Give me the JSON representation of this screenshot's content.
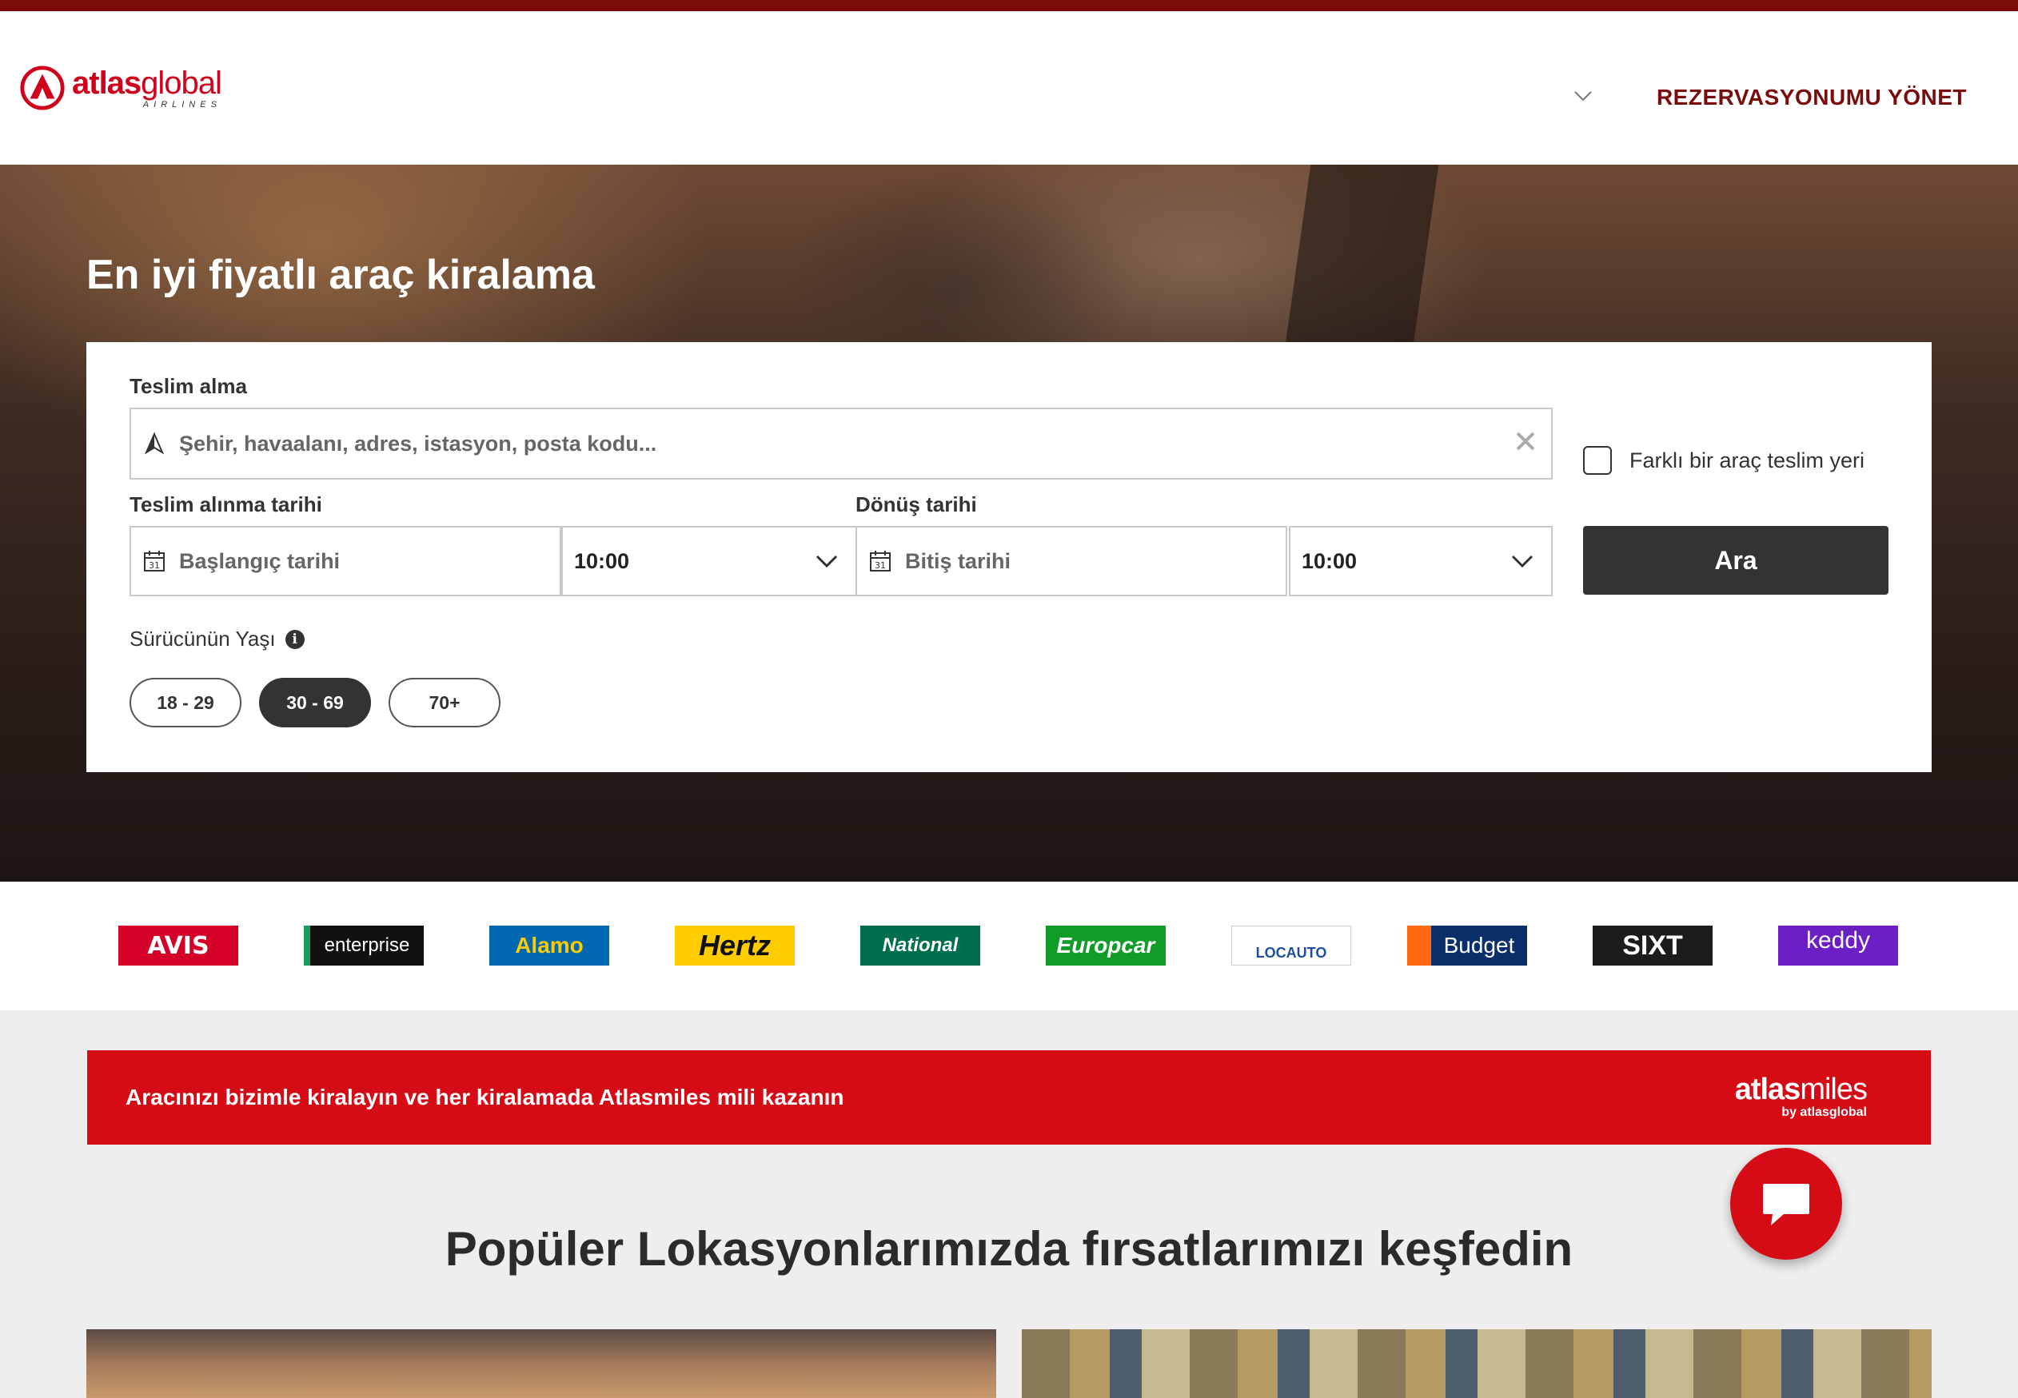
{
  "header": {
    "logo": {
      "brand": "atlas",
      "brand_light": "global",
      "sub": "AIRLINES"
    },
    "manage_booking": "REZERVASYONUMU YÖNET"
  },
  "hero": {
    "title": "En iyi fiyatlı araç kiralama"
  },
  "search": {
    "pickup_label": "Teslim alma",
    "pickup_placeholder": "Şehir, havaalanı, adres, istasyon, posta kodu...",
    "different_dropoff_label": "Farklı bir araç teslim yeri",
    "pickup_date_label": "Teslim alınma tarihi",
    "pickup_date_placeholder": "Başlangıç tarihi",
    "pickup_time": "10:00",
    "return_date_label": "Dönüş tarihi",
    "return_date_placeholder": "Bitiş tarihi",
    "return_time": "10:00",
    "search_button": "Ara",
    "calendar_day": "31",
    "driver_age_label": "Sürücünün Yaşı",
    "info_glyph": "i",
    "age_options": [
      "18 - 29",
      "30 - 69",
      "70+"
    ],
    "selected_age": "30 - 69"
  },
  "brands": [
    "AVIS",
    "enterprise",
    "Alamo",
    "Hertz",
    "National",
    "Europcar",
    "LOCAUTO",
    "Budget",
    "SIXT",
    "keddy"
  ],
  "promo": {
    "text": "Aracınızı bizimle kiralayın ve her kiralamada Atlasmiles mili kazanın",
    "logo_bold": "atlas",
    "logo_light": "miles",
    "logo_sub": "by atlasglobal"
  },
  "popular": {
    "title": "Popüler Lokasyonlarımızda fırsatlarımızı keşfedin"
  },
  "colors": {
    "brand_red": "#d50c16",
    "dark_red": "#7a0c0c",
    "button_dark": "#333333"
  }
}
